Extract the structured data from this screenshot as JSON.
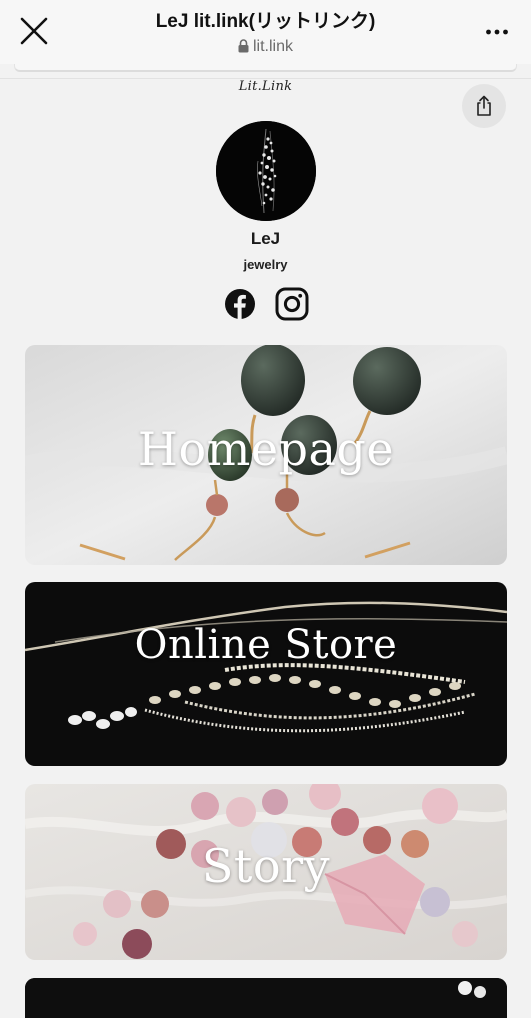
{
  "browser": {
    "title": "LeJ lit.link(リットリンク)",
    "domain": "lit.link",
    "close_icon": "close-icon",
    "lock_icon": "lock-icon",
    "more_icon": "more-dots-icon"
  },
  "page": {
    "brand_logo": "Lit.Link",
    "share_icon": "share-icon"
  },
  "profile": {
    "name": "LeJ",
    "bio": "jewelry",
    "social": [
      {
        "icon": "facebook-icon"
      },
      {
        "icon": "instagram-icon"
      }
    ]
  },
  "links": [
    {
      "label": "Homepage"
    },
    {
      "label": "Online Store"
    },
    {
      "label": "Story"
    }
  ],
  "colors": {
    "background": "#f2f2f2",
    "text": "#111111",
    "card_label": "#ffffff"
  }
}
